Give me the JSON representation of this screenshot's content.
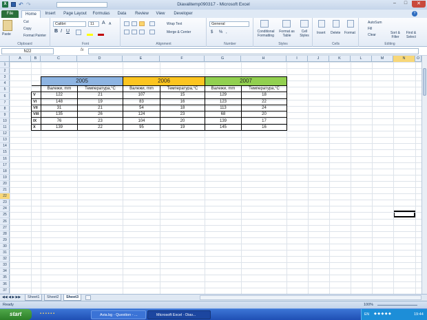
{
  "window": {
    "title": "Diavalitemp090317  -  Microsoft Excel"
  },
  "qat": {
    "dropdown_label": ""
  },
  "tabs": [
    "File",
    "Home",
    "Insert",
    "Page Layout",
    "Formulas",
    "Data",
    "Review",
    "View",
    "Developer"
  ],
  "ribbon": {
    "clipboard": {
      "label": "Clipboard",
      "paste": "Paste",
      "cut": "Cut",
      "copy": "Copy",
      "format_painter": "Format Painter"
    },
    "font": {
      "label": "Font",
      "name": "Calibri",
      "size": "11",
      "bold": "B",
      "italic": "I",
      "underline": "U",
      "grow": "A",
      "shrink": "A"
    },
    "alignment": {
      "label": "Alignment",
      "wrap": "Wrap Text",
      "merge": "Merge & Center"
    },
    "number": {
      "label": "Number",
      "format": "General",
      "currency": "$",
      "percent": "%",
      "comma": ","
    },
    "styles": {
      "label": "Styles",
      "cond": "Conditional Formatting",
      "table": "Format as Table",
      "cell": "Cell Styles"
    },
    "cells": {
      "label": "Cells",
      "insert": "Insert",
      "delete": "Delete",
      "format": "Format"
    },
    "editing": {
      "label": "Editing",
      "autosum": "AutoSum",
      "fill": "Fill",
      "clear": "Clear",
      "sort": "Sort & Filter",
      "find": "Find & Select"
    }
  },
  "formula_bar": {
    "name_box": "N22",
    "fx": "fx",
    "value": ""
  },
  "columns": [
    "A",
    "B",
    "C",
    "D",
    "E",
    "F",
    "G",
    "H",
    "I",
    "J",
    "K",
    "L",
    "M",
    "N",
    "O"
  ],
  "rows": [
    "1",
    "2",
    "3",
    "4",
    "5",
    "6",
    "7",
    "8",
    "9",
    "10",
    "11",
    "12",
    "13",
    "14",
    "15",
    "16",
    "17",
    "18",
    "19",
    "20",
    "21",
    "22",
    "23",
    "24",
    "25",
    "26",
    "27",
    "28",
    "29",
    "30",
    "31",
    "32",
    "33",
    "34",
    "35",
    "36",
    "37"
  ],
  "table": {
    "years": [
      "2005",
      "2006",
      "2007"
    ],
    "year_colors": [
      "#8db4e2",
      "#fcc521",
      "#92d050"
    ],
    "sub_headers": [
      "Валежи, mm",
      "Температура,°C"
    ],
    "rows": [
      {
        "month": "V",
        "values": [
          "122",
          "21",
          "107",
          "15",
          "129",
          "18"
        ]
      },
      {
        "month": "VI",
        "values": [
          "148",
          "19",
          "83",
          "16",
          "123",
          "22"
        ]
      },
      {
        "month": "VII",
        "values": [
          "31",
          "21",
          "54",
          "18",
          "113",
          "24"
        ]
      },
      {
        "month": "VIII",
        "values": [
          "135",
          "26",
          "124",
          "23",
          "68",
          "20"
        ]
      },
      {
        "month": "IX",
        "values": [
          "76",
          "23",
          "104",
          "20",
          "139",
          "17"
        ]
      },
      {
        "month": "X",
        "values": [
          "139",
          "22",
          "95",
          "19",
          "145",
          "16"
        ]
      }
    ]
  },
  "sheets": [
    "Sheet1",
    "Sheet2",
    "Sheet3"
  ],
  "active_sheet": "Sheet3",
  "status": {
    "ready": "Ready",
    "zoom": "100%"
  },
  "taskbar": {
    "start": "start",
    "items": [
      "Avia.bg - Question - ...",
      "Microsoft Excel - Diav..."
    ],
    "lang": "EN",
    "time": "19:44"
  }
}
